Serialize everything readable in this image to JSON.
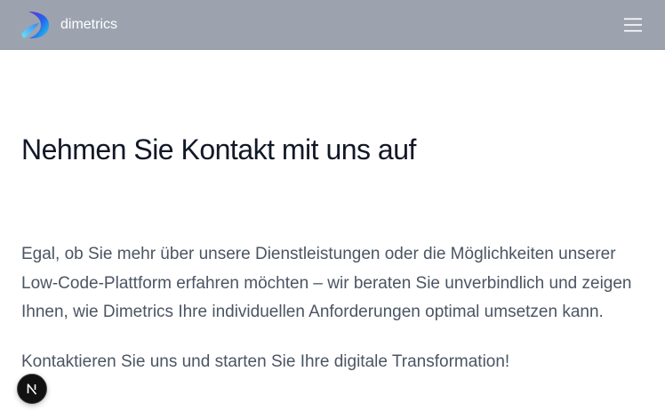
{
  "header": {
    "brand_name": "dimetrics",
    "logo_icon": "dimetrics-logo-icon",
    "menu_icon": "hamburger-menu-icon",
    "background_color": "#9ca3af"
  },
  "main": {
    "title": "Nehmen Sie Kontakt mit uns auf",
    "intro_text": "Egal, ob Sie mehr über unsere Dienstleistungen oder die Möglichkeiten unserer Low-Code-Plattform erfahren möchten – wir beraten Sie unverbindlich und zeigen Ihnen, wie Dimetrics Ihre individuellen Anforderungen optimal umsetzen kann.",
    "cta_text": "Kontaktieren Sie uns und starten Sie Ihre digitale Transformation!"
  },
  "badge": {
    "icon": "nextjs-dev-indicator-icon",
    "glyph": "N"
  },
  "colors": {
    "title": "#111827",
    "body_text": "#4b5563",
    "logo_blue": "#2563eb",
    "logo_purple": "#7c3aed",
    "logo_cyan": "#22d3ee"
  }
}
